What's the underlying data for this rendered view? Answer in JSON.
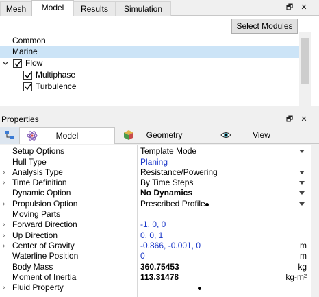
{
  "top_tabs": [
    {
      "label": "Mesh"
    },
    {
      "label": "Model"
    },
    {
      "label": "Results"
    },
    {
      "label": "Simulation"
    }
  ],
  "window_controls": {
    "float": "🗗",
    "close": "✕"
  },
  "modules": {
    "select_button": "Select Modules",
    "items": [
      {
        "label": "Common"
      },
      {
        "label": "Marine"
      },
      {
        "label": "Flow"
      },
      {
        "label": "Multiphase"
      },
      {
        "label": "Turbulence"
      }
    ]
  },
  "properties": {
    "title": "Properties",
    "tabs": [
      {
        "label": "Model"
      },
      {
        "label": "Geometry"
      },
      {
        "label": "View"
      }
    ],
    "rows": [
      {
        "name": "Setup Options",
        "value": "Template Mode"
      },
      {
        "name": "Hull Type",
        "value": "Planing"
      },
      {
        "name": "Analysis Type",
        "value": "Resistance/Powering"
      },
      {
        "name": "Time Definition",
        "value": "By Time Steps"
      },
      {
        "name": "Dynamic Option",
        "value": "No Dynamics"
      },
      {
        "name": "Propulsion Option",
        "value": "Prescribed Profile"
      },
      {
        "name": "Moving Parts",
        "value": ""
      },
      {
        "name": "Forward Direction",
        "value": "-1, 0, 0"
      },
      {
        "name": "Up Direction",
        "value": "0, 0, 1"
      },
      {
        "name": "Center of Gravity",
        "value": "-0.866, -0.001, 0",
        "unit": "m"
      },
      {
        "name": "Waterline Position",
        "value": "0",
        "unit": "m"
      },
      {
        "name": "Body Mass",
        "value": "360.75453",
        "unit": "kg"
      },
      {
        "name": "Moment of Inertia",
        "value": "113.31478",
        "unit": "kg-m²"
      },
      {
        "name": "Fluid Property",
        "value": ""
      }
    ]
  }
}
